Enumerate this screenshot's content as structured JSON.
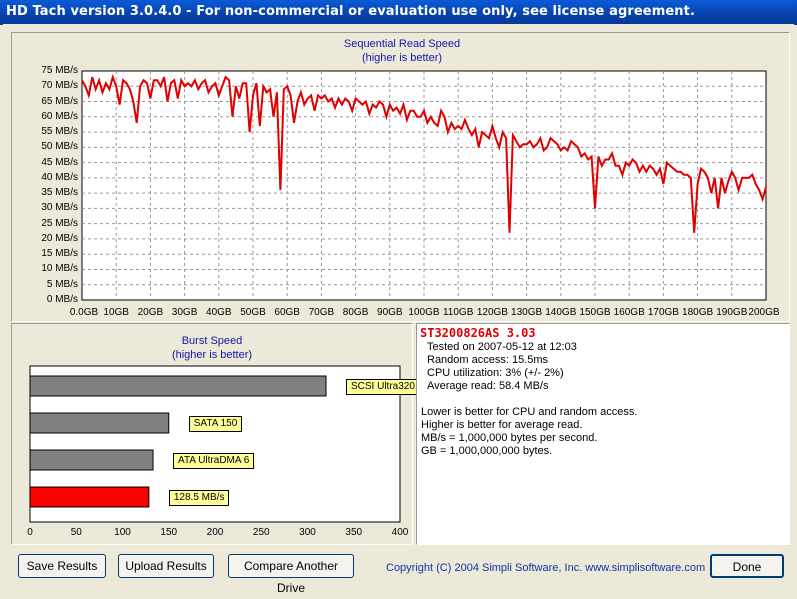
{
  "window": {
    "title": "HD Tach version 3.0.4.0  - For non-commercial or evaluation use only, see license agreement."
  },
  "seq_chart": {
    "title": "Sequential Read Speed",
    "subtitle": "(higher is better)",
    "y_ticks": [
      "75 MB/s",
      "70 MB/s",
      "65 MB/s",
      "60 MB/s",
      "55 MB/s",
      "50 MB/s",
      "45 MB/s",
      "40 MB/s",
      "35 MB/s",
      "30 MB/s",
      "25 MB/s",
      "20 MB/s",
      "15 MB/s",
      "10 MB/s",
      "5 MB/s",
      "0 MB/s"
    ],
    "x_ticks": [
      "0.0GB",
      "10GB",
      "20GB",
      "30GB",
      "40GB",
      "50GB",
      "60GB",
      "70GB",
      "80GB",
      "90GB",
      "100GB",
      "110GB",
      "120GB",
      "130GB",
      "140GB",
      "150GB",
      "160GB",
      "170GB",
      "180GB",
      "190GB",
      "200GB"
    ]
  },
  "burst_chart": {
    "title": "Burst Speed",
    "subtitle": "(higher is better)",
    "x_ticks": [
      "0",
      "50",
      "100",
      "150",
      "200",
      "250",
      "300",
      "350",
      "400"
    ],
    "bars": [
      {
        "label": "SCSI Ultra320",
        "value": 320,
        "color": "#808080"
      },
      {
        "label": "SATA 150",
        "value": 150,
        "color": "#808080"
      },
      {
        "label": "ATA UltraDMA 6",
        "value": 133,
        "color": "#808080"
      },
      {
        "label": "128.5 MB/s",
        "value": 128.5,
        "color": "#ff0000"
      }
    ]
  },
  "info": {
    "drive": "ST3200826AS 3.03",
    "tested": "Tested on 2007-05-12 at 12:03",
    "random_access": "Random access: 15.5ms",
    "cpu": "CPU utilization: 3% (+/- 2%)",
    "average_read": "Average read: 58.4 MB/s",
    "note1": "Lower is better for CPU and random access.",
    "note2": "Higher is better for average read.",
    "note3": "MB/s = 1,000,000 bytes per second.",
    "note4": "GB = 1,000,000,000 bytes."
  },
  "buttons": {
    "save": "Save Results",
    "upload": "Upload Results",
    "compare": "Compare Another Drive",
    "done": "Done"
  },
  "copyright": "Copyright (C) 2004 Simpli Software, Inc. www.simplisoftware.com",
  "chart_data": [
    {
      "type": "line",
      "title": "Sequential Read Speed",
      "subtitle": "(higher is better)",
      "xlabel": "",
      "ylabel": "",
      "xlim": [
        0,
        200
      ],
      "ylim": [
        0,
        75
      ],
      "grid": true,
      "series": [
        {
          "color": "#e00000",
          "x": [
            0,
            1,
            2,
            3,
            4,
            5,
            6,
            7,
            8,
            9,
            10,
            11,
            12,
            13,
            14,
            15,
            16,
            17,
            18,
            19,
            20,
            21,
            22,
            23,
            24,
            25,
            26,
            27,
            28,
            29,
            30,
            31,
            32,
            33,
            34,
            35,
            36,
            37,
            38,
            39,
            40,
            41,
            42,
            43,
            44,
            45,
            46,
            47,
            48,
            49,
            50,
            51,
            52,
            53,
            54,
            55,
            56,
            57,
            58,
            59,
            60,
            61,
            62,
            63,
            64,
            65,
            66,
            67,
            68,
            69,
            70,
            71,
            72,
            73,
            74,
            75,
            76,
            77,
            78,
            79,
            80,
            81,
            82,
            83,
            84,
            85,
            86,
            87,
            88,
            89,
            90,
            91,
            92,
            93,
            94,
            95,
            96,
            97,
            98,
            99,
            100,
            101,
            102,
            103,
            104,
            105,
            106,
            107,
            108,
            109,
            110,
            111,
            112,
            113,
            114,
            115,
            116,
            117,
            118,
            119,
            120,
            121,
            122,
            123,
            124,
            125,
            126,
            127,
            128,
            129,
            130,
            131,
            132,
            133,
            134,
            135,
            136,
            137,
            138,
            139,
            140,
            141,
            142,
            143,
            144,
            145,
            146,
            147,
            148,
            149,
            150,
            151,
            152,
            153,
            154,
            155,
            156,
            157,
            158,
            159,
            160,
            161,
            162,
            163,
            164,
            165,
            166,
            167,
            168,
            169,
            170,
            171,
            172,
            173,
            174,
            175,
            176,
            177,
            178,
            179,
            180,
            181,
            182,
            183,
            184,
            185,
            186,
            187,
            188,
            189,
            190,
            191,
            192,
            193,
            194,
            195,
            196,
            197,
            198,
            199,
            200
          ],
          "y": [
            72,
            70,
            67,
            73,
            69,
            72,
            68,
            71,
            69,
            73,
            70,
            64,
            72,
            71,
            69,
            65,
            58,
            70,
            72,
            71,
            66,
            72,
            72,
            70,
            73,
            65,
            71,
            72,
            66,
            72,
            70,
            71,
            70,
            72,
            69,
            71,
            72,
            68,
            70,
            71,
            67,
            70,
            73,
            72,
            60,
            70,
            66,
            71,
            71,
            55,
            67,
            71,
            57,
            70,
            68,
            69,
            60,
            68,
            36,
            69,
            70,
            67,
            58,
            65,
            68,
            64,
            66,
            67,
            62,
            67,
            66,
            67,
            65,
            66,
            63,
            66,
            64,
            66,
            65,
            62,
            66,
            65,
            64,
            65,
            61,
            64,
            63,
            65,
            64,
            60,
            64,
            62,
            63,
            61,
            64,
            59,
            62,
            62,
            60,
            60,
            62,
            58,
            60,
            58,
            57,
            62,
            60,
            55,
            58,
            56,
            57,
            56,
            59,
            56,
            54,
            56,
            50,
            55,
            54,
            53,
            57,
            53,
            50,
            55,
            53,
            22,
            54,
            52,
            50,
            51,
            51,
            52,
            50,
            51,
            53,
            49,
            50,
            53,
            52,
            51,
            49,
            50,
            49,
            52,
            51,
            50,
            47,
            48,
            46,
            47,
            30,
            47,
            44,
            46,
            46,
            48,
            44,
            44,
            41,
            45,
            44,
            46,
            45,
            42,
            44,
            42,
            44,
            43,
            41,
            43,
            38,
            45,
            44,
            43,
            42,
            42,
            41,
            41,
            40,
            22,
            38,
            43,
            42,
            40,
            35,
            40,
            30,
            40,
            35,
            39,
            42,
            40,
            36,
            40,
            40,
            40,
            41,
            38,
            36,
            33,
            37
          ]
        }
      ]
    },
    {
      "type": "bar",
      "title": "Burst Speed",
      "subtitle": "(higher is better)",
      "orientation": "horizontal",
      "categories": [
        "SCSI Ultra320",
        "SATA 150",
        "ATA UltraDMA 6",
        "128.5 MB/s"
      ],
      "values": [
        320,
        150,
        133,
        128.5
      ],
      "xlim": [
        0,
        400
      ],
      "grid": false
    }
  ]
}
